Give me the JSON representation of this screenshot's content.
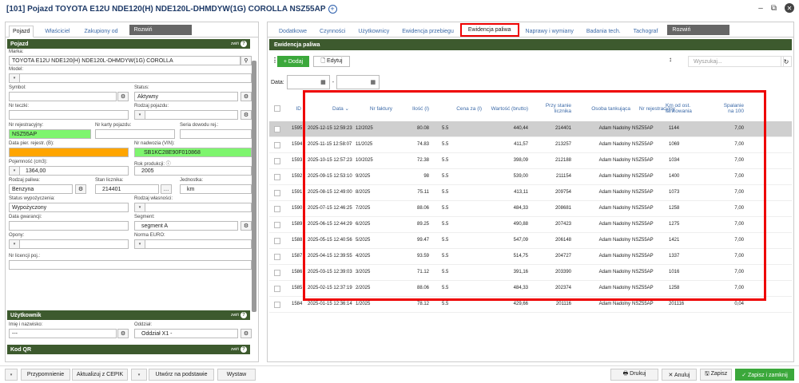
{
  "title": "[101] Pojazd TOYOTA E12U NDE120(H) NDE120L-DHMDYW(1G) COROLLA NSZ55AP",
  "window": {
    "minimize": "–",
    "restore": "⧉",
    "close": "✕"
  },
  "left_tabs": [
    "Pojazd",
    "Właściciel",
    "Zakupiony od"
  ],
  "left_rozwin": "Rozwiń",
  "sec_pojazd": "Pojazd",
  "zwin": "zwiń",
  "form": {
    "marka_lbl": "Marka:",
    "marka": "TOYOTA E12U NDE120(H) NDE120L-DHMDYW(1G) COROLLA",
    "model_lbl": "Model:",
    "symbol_lbl": "Symbol:",
    "status_lbl": "Status:",
    "status": "Aktywny",
    "nrteczki_lbl": "Nr teczki:",
    "rodzaj_lbl": "Rodzaj pojazdu:",
    "nrrej_lbl": "Nr rejestracyjny:",
    "nrkarty_lbl": "Nr karty pojazdu:",
    "seria_lbl": "Seria dowodu rej.:",
    "nrrej": "NSZ55AP",
    "datapier_lbl": "Data pier. rejestr. (B):",
    "vin_lbl": "Nr nadwozia (VIN):",
    "vin": "SB1KC28E90F010868",
    "pojemnosc_lbl": "Pojemność (cm3):",
    "pojemnosc": "1364,00",
    "rok_lbl": "Rok produkcji: ⓘ",
    "rok": "2005",
    "paliwo_lbl": "Rodzaj paliwa:",
    "paliwo": "Benzyna",
    "stanlicz_lbl": "Stan licznika:",
    "stanlicz": "214401",
    "jedn_lbl": "Jednostka:",
    "jedn": "km",
    "statwyp_lbl": "Status wypożyczenia:",
    "statwyp": "Wypożyczony",
    "rodzwl_lbl": "Rodzaj własności:",
    "gwar_lbl": "Data gwarancji:",
    "segment_lbl": "Segment:",
    "segment": "segment A",
    "opony_lbl": "Opony:",
    "euro_lbl": "Norma EURO:",
    "licencji_lbl": "Nr licencji poj.:"
  },
  "sec_uzytkownik": "Użytkownik",
  "user": {
    "imie_lbl": "Imię i nazwisko:",
    "imie": "---",
    "oddzial_lbl": "Oddział:",
    "oddzial": "Oddział X1 -"
  },
  "sec_kodqr": "Kod QR",
  "right_tabs": [
    "Dodatkowe",
    "Czynności",
    "Użytkownicy",
    "Ewidencja przebiegu",
    "Ewidencja paliwa",
    "Naprawy i wymiany",
    "Badania tech.",
    "Tachograf"
  ],
  "right_rozwin": "Rozwiń",
  "sec_ewidencja": "Ewidencja paliwa",
  "toolbar": {
    "dodaj": "+ Dodaj",
    "edytuj": "🗋 Edytuj",
    "search_placeholder": "Wyszukaj...",
    "data_lbl": "Data:"
  },
  "columns": [
    "ID",
    "Data ⌄",
    "Nr faktury",
    "Ilość (l)",
    "Cena za (l)",
    "Wartość (brutto)",
    "Przy stanie licznika",
    "Osoba tankująca",
    "Nr rejestracyjny",
    "Km od ost. tankowania",
    "Spalanie na 100"
  ],
  "rows": [
    [
      "1595",
      "2025-12-15 12:59:23",
      "12/2025",
      "80.08",
      "5.5",
      "440,44",
      "214401",
      "Adam Nadolny",
      "NSZ55AP",
      "1144",
      "7,00"
    ],
    [
      "1594",
      "2025-11-15 12:58:07",
      "11/2025",
      "74.83",
      "5.5",
      "411,57",
      "213257",
      "Adam Nadolny",
      "NSZ55AP",
      "1069",
      "7,00"
    ],
    [
      "1593",
      "2025-10-15 12:57:23",
      "10/2025",
      "72.38",
      "5.5",
      "398,09",
      "212188",
      "Adam Nadolny",
      "NSZ55AP",
      "1034",
      "7,00"
    ],
    [
      "1592",
      "2025-09-15 12:53:10",
      "9/2025",
      "98",
      "5.5",
      "539,00",
      "211154",
      "Adam Nadolny",
      "NSZ55AP",
      "1400",
      "7,00"
    ],
    [
      "1591",
      "2025-08-15 12:49:00",
      "8/2025",
      "75.11",
      "5.5",
      "413,11",
      "209754",
      "Adam Nadolny",
      "NSZ55AP",
      "1073",
      "7,00"
    ],
    [
      "1590",
      "2025-07-15 12:46:25",
      "7/2025",
      "88.06",
      "5.5",
      "484,33",
      "208681",
      "Adam Nadolny",
      "NSZ55AP",
      "1258",
      "7,00"
    ],
    [
      "1589",
      "2025-06-15 12:44:29",
      "6/2025",
      "89.25",
      "5.5",
      "490,88",
      "207423",
      "Adam Nadolny",
      "NSZ55AP",
      "1275",
      "7,00"
    ],
    [
      "1588",
      "2025-05-15 12:40:56",
      "5/2025",
      "99.47",
      "5.5",
      "547,09",
      "206148",
      "Adam Nadolny",
      "NSZ55AP",
      "1421",
      "7,00"
    ],
    [
      "1587",
      "2025-04-15 12:39:55",
      "4/2025",
      "93.59",
      "5.5",
      "514,75",
      "204727",
      "Adam Nadolny",
      "NSZ55AP",
      "1337",
      "7,00"
    ],
    [
      "1586",
      "2025-03-15 12:39:03",
      "3/2025",
      "71.12",
      "5.5",
      "391,16",
      "203390",
      "Adam Nadolny",
      "NSZ55AP",
      "1016",
      "7,00"
    ],
    [
      "1585",
      "2025-02-15 12:37:19",
      "2/2025",
      "88.06",
      "5.5",
      "484,33",
      "202374",
      "Adam Nadolny",
      "NSZ55AP",
      "1258",
      "7,00"
    ],
    [
      "1584",
      "2025-01-15 12:36:14",
      "1/2025",
      "78.12",
      "5.5",
      "429,66",
      "201116",
      "Adam Nadolny",
      "NSZ55AP",
      "201116",
      "0,04"
    ]
  ],
  "bottom": {
    "przypomnienie": "Przypomnienie",
    "cepik": "Aktualizuj z CEPIK",
    "utworz": "Utwórz na podstawie",
    "wystaw": "Wystaw",
    "drukuj": "🖶 Drukuj",
    "anuluj": "✕ Anuluj",
    "zapisz": "🖫 Zapisz",
    "zapisz_zamknij": "✓ Zapisz i zamknij"
  }
}
